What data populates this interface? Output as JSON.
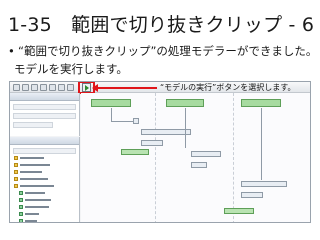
{
  "slide": {
    "title": "1-35　範囲で切り抜きクリップ - 6",
    "bullet_mark": "•",
    "bullet_line1": "“範囲で切り抜きクリップ”の処理モデラーができました。",
    "bullet_line2": "モデルを実行します。"
  },
  "callout": {
    "text": "“モデルの実行”ボタンを選択します。"
  },
  "colors": {
    "highlight": "#e0161b",
    "lane_head": "#a7dba0"
  },
  "icons": {
    "run": "play-icon"
  }
}
